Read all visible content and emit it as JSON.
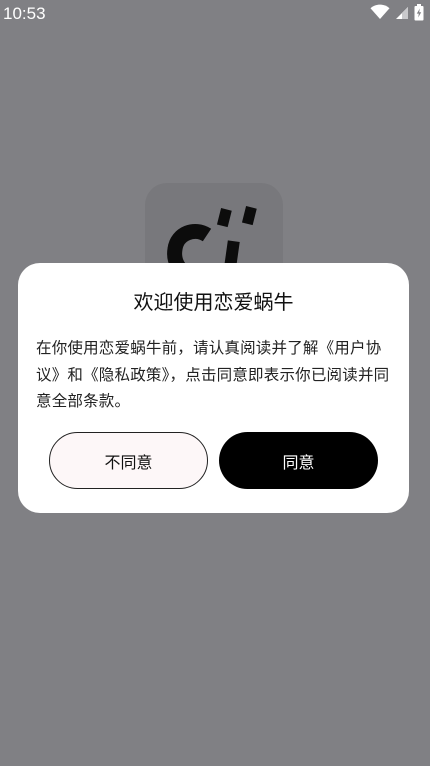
{
  "status_bar": {
    "time": "10:53",
    "icons": [
      "wifi-icon",
      "cellular-signal-icon",
      "battery-icon"
    ]
  },
  "background": {
    "logo_icon": "app-logo-icon"
  },
  "dialog": {
    "title": "欢迎使用恋爱蜗牛",
    "body": "在你使用恋爱蜗牛前，请认真阅读并了解《用户协议》和《隐私政策》，点击同意即表示你已阅读并同意全部条款。",
    "disagree_label": "不同意",
    "agree_label": "同意"
  },
  "colors": {
    "scrim": "#808084",
    "dialog_bg": "#ffffff",
    "agree_bg": "#000000",
    "disagree_bg": "#fdf7f8"
  }
}
